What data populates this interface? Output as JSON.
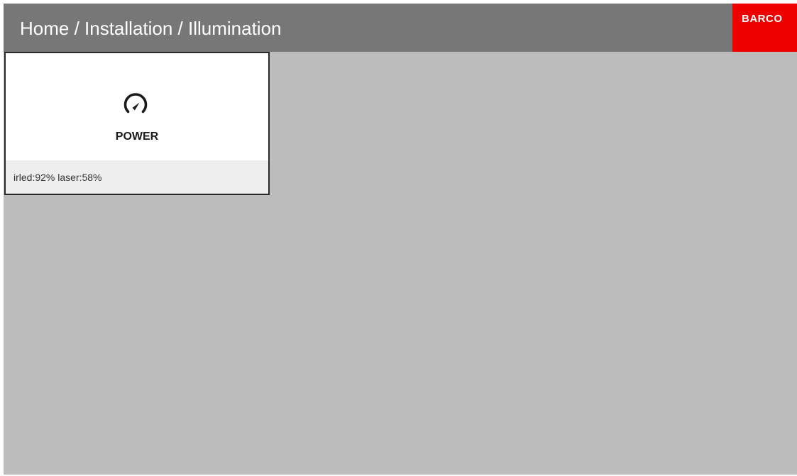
{
  "header": {
    "breadcrumb": "Home / Installation / Illumination",
    "logo_text": "BARCO",
    "logo_color": "#ee0000",
    "background_color": "#777777"
  },
  "main": {
    "background_color": "#bcbcbc",
    "tiles": [
      {
        "label": "POWER",
        "icon": "speedometer-icon",
        "status": "irled:92% laser:58%",
        "selected": true
      }
    ]
  }
}
